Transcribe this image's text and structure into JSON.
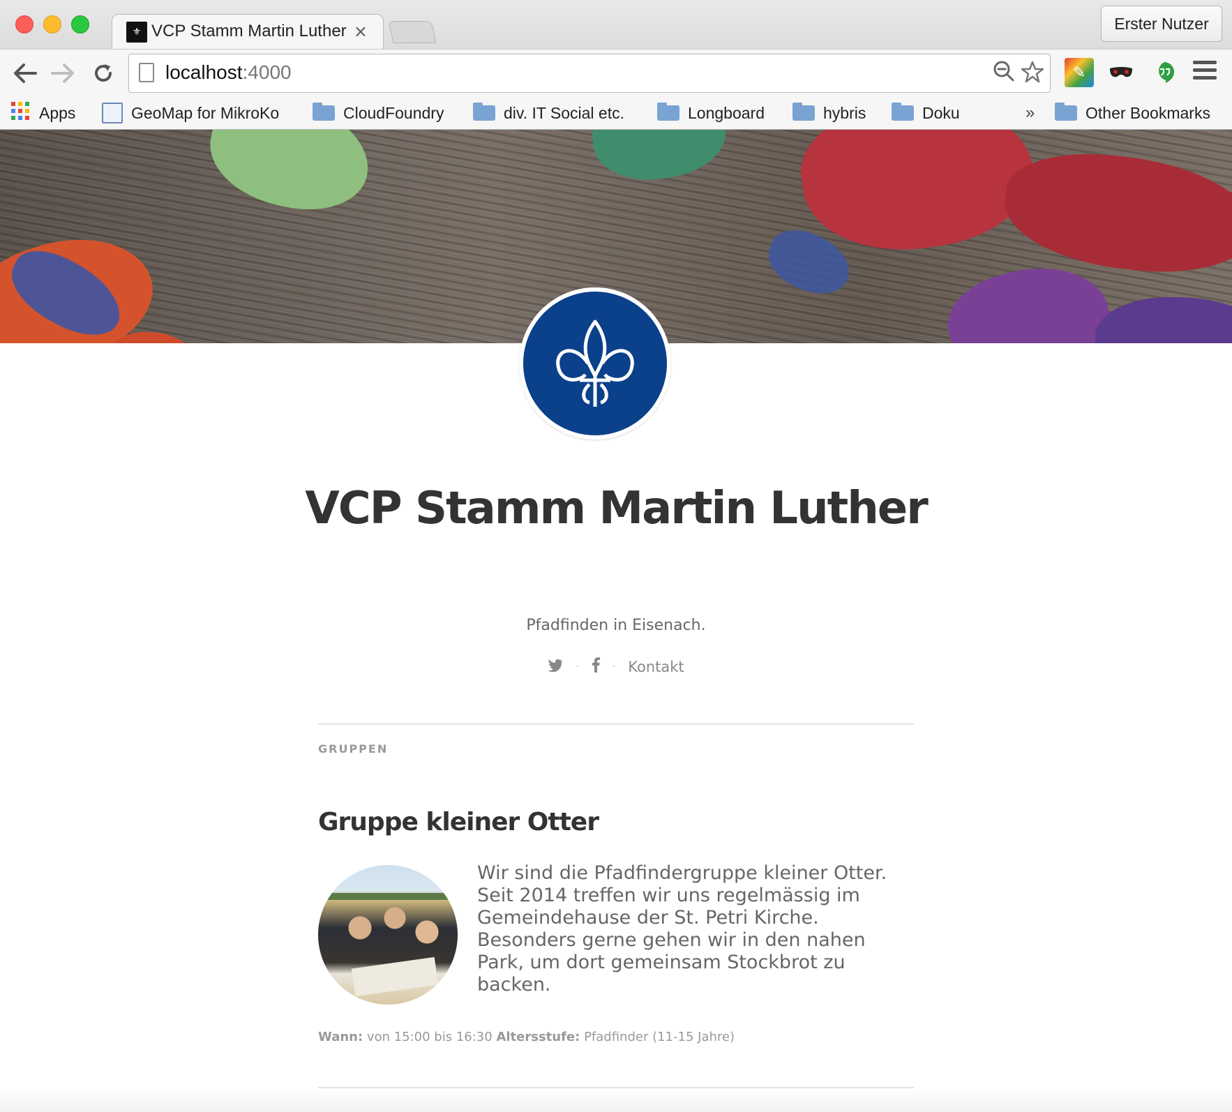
{
  "browser": {
    "tab_title": "VCP Stamm Martin Luther",
    "tab_close": "×",
    "profile_button": "Erster Nutzer",
    "url_host": "localhost",
    "url_port": ":4000",
    "bookmarks": {
      "apps": "Apps",
      "items": [
        "GeoMap for MikroKo",
        "CloudFoundry",
        "div. IT Social etc.",
        "Longboard",
        "hybris",
        "Doku"
      ],
      "more": "»",
      "other": "Other Bookmarks"
    }
  },
  "page": {
    "title": "VCP Stamm Martin Luther",
    "description": "Pfadfinden in Eisenach.",
    "social": {
      "separator": "·",
      "contact": "Kontakt"
    },
    "section_label": "GRUPPEN",
    "group": {
      "title": "Gruppe kleiner Otter",
      "text": "Wir sind die Pfadfindergruppe kleiner Otter. Seit 2014 treffen wir uns regelmässig im Gemeindehause der St. Petri Kirche. Besonders gerne gehen wir in den nahen Park, um dort gemeinsam Stockbrot zu backen.",
      "when_label": "Wann:",
      "when_value": "von 15:00 bis 16:30",
      "age_label": "Altersstufe:",
      "age_value": "Pfadfinder (11-15 Jahre)"
    }
  },
  "colors": {
    "logo_blue": "#0b408a",
    "text_dark": "#333333",
    "text_muted": "#666666"
  }
}
